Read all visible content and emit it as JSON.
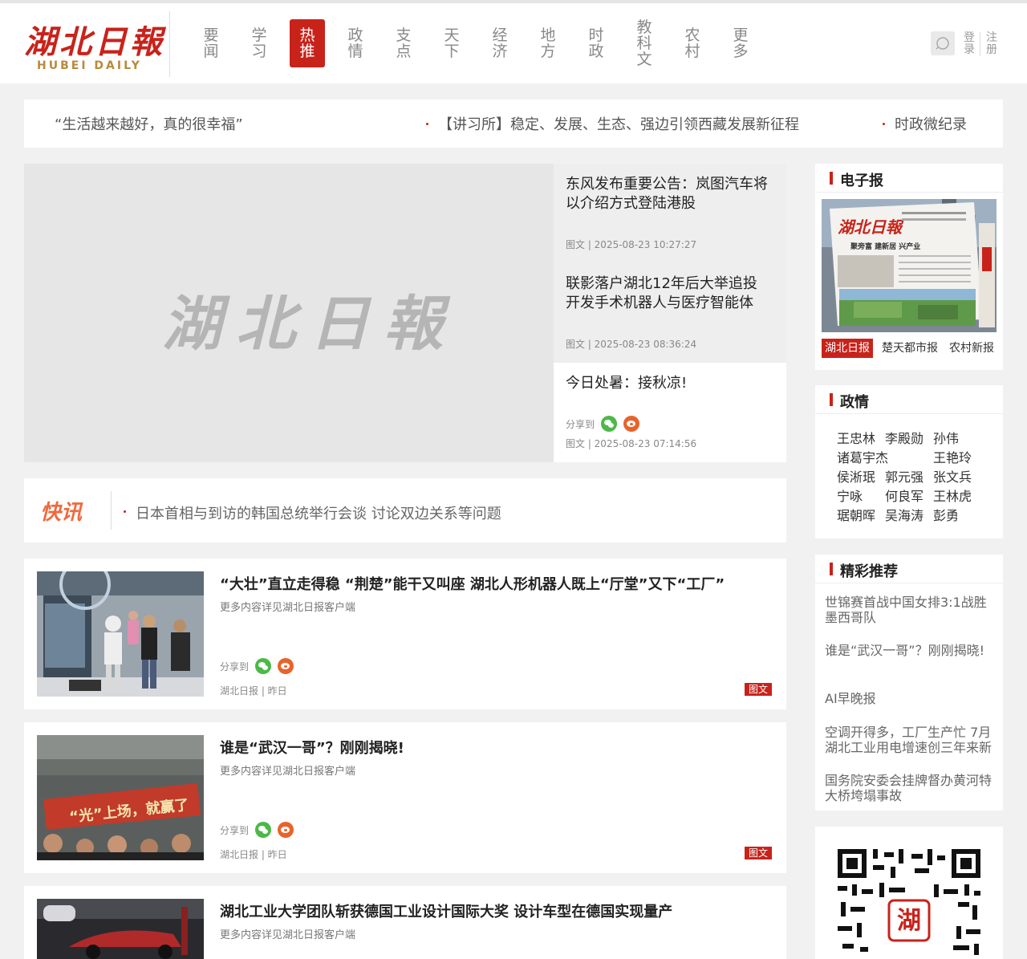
{
  "header": {
    "logo_cn": "湖北日報",
    "logo_en": "HUBEI DAILY",
    "nav": [
      "要闻",
      "学习",
      "热推",
      "政情",
      "支点",
      "天下",
      "经济",
      "地方",
      "时政",
      "教科文",
      "农村",
      "更多"
    ],
    "active_nav": "热推",
    "login": "登录",
    "register": "注册"
  },
  "ticker": [
    "“生活越来越好，真的很幸福”",
    "【讲习所】稳定、发展、生态、强边引领西藏发展新征程",
    "时政微纪录"
  ],
  "hero": {
    "watermark": "湖北日報",
    "news": [
      {
        "title": "东风发布重要公告：岚图汽车将以介绍方式登陆港股",
        "meta": "图文 | 2025-08-23 10:27:27"
      },
      {
        "title": "联影落户湖北12年后大举追投 开发手术机器人与医疗智能体",
        "meta": "图文 | 2025-08-23 08:36:24"
      },
      {
        "title": "今日处暑：接秋凉!",
        "share_label": "分享到",
        "meta": "图文 | 2025-08-23 07:14:56"
      }
    ]
  },
  "flash": {
    "label": "快讯",
    "text": "日本首相与到访的韩国总统举行会谈 讨论双边关系等问题"
  },
  "articles": [
    {
      "title": "“大壮”直立走得稳 “荆楚”能干又叫座 湖北人形机器人既上“厅堂”又下“工厂”",
      "sub": "更多内容详见湖北日报客户端",
      "share_label": "分享到",
      "meta": "湖北日报 | 昨日",
      "tag": "图文"
    },
    {
      "title": "谁是“武汉一哥”？刚刚揭晓!",
      "sub": "更多内容详见湖北日报客户端",
      "share_label": "分享到",
      "meta": "湖北日报 | 昨日",
      "tag": "图文",
      "banner_text": "“光”上场，就赢了"
    },
    {
      "title": "湖北工业大学团队斩获德国工业设计国际大奖 设计车型在德国实现量产",
      "sub": "更多内容详见湖北日报客户端"
    }
  ],
  "epaper": {
    "title": "电子报",
    "tabs": [
      "湖北日报",
      "楚天都市报",
      "农村新报"
    ],
    "active_tab": "湖北日报",
    "thumbnail": {
      "masthead": "湖北日報",
      "headline": "聚旁富 建新居 兴产业"
    }
  },
  "politics": {
    "title": "政情",
    "names": [
      "王忠林",
      "李殿勋",
      "孙伟",
      "诸葛宇杰",
      "",
      "王艳玲",
      "侯淅珉",
      "郭元强",
      "张文兵",
      "宁咏",
      "何良军",
      "王林虎",
      "琚朝晖",
      "吴海涛",
      "彭勇"
    ]
  },
  "recommend": {
    "title": "精彩推荐",
    "items": [
      "世锦赛首战中国女排3:1战胜墨西哥队",
      "谁是“武汉一哥”？刚刚揭晓!",
      "AI早晚报",
      "空调开得多，工厂生产忙 7月湖北工业用电增速创三年来新高",
      "国务院安委会挂牌督办黄河特大桥垮塌事故"
    ]
  },
  "qr": {
    "center_char": "湖"
  },
  "colors": {
    "brand_red": "#c8231b",
    "flash_orange": "#ef6a3d",
    "gold": "#b88a3b",
    "wechat_green": "#4cb848",
    "weibo_orange": "#e8632b"
  }
}
